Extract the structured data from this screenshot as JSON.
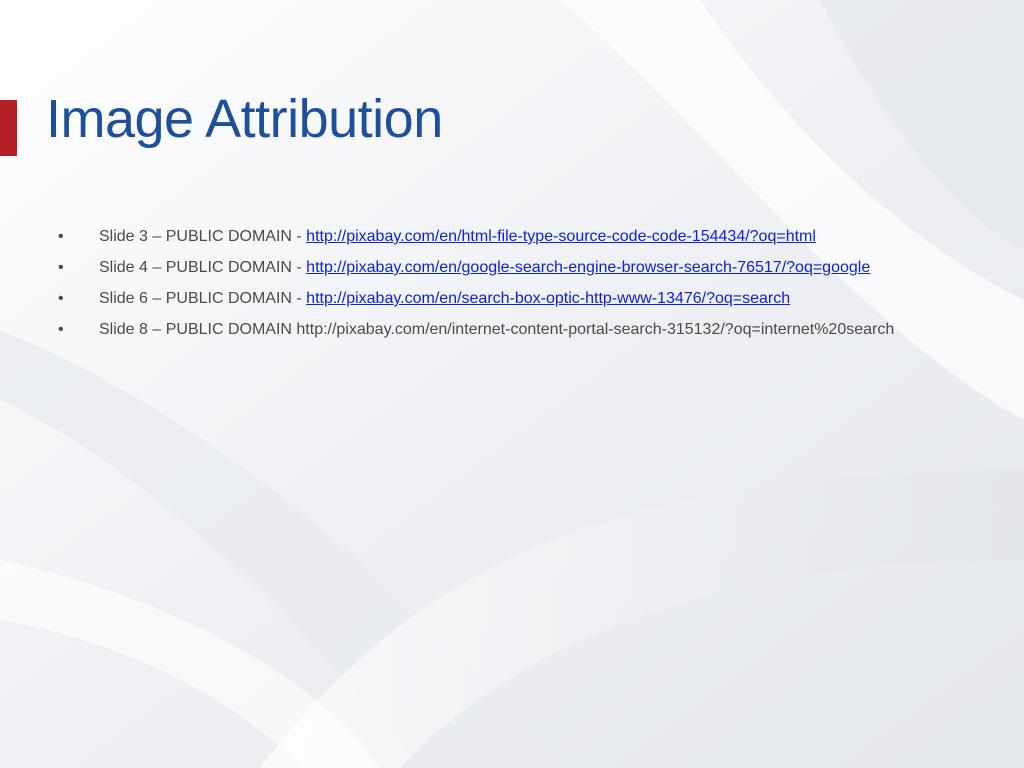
{
  "slide": {
    "title": "Image Attribution",
    "colors": {
      "title": "#1d4f9a",
      "accent": "#b21f24",
      "link": "#0b22d8",
      "text": "#4a4a4a"
    },
    "bullet_symbol": "•",
    "bullets": [
      {
        "prefix": "Slide 3 – PUBLIC DOMAIN - ",
        "link": "http://pixabay.com/en/html-file-type-source-code-code-154434/?oq=html"
      },
      {
        "prefix": "Slide 4 – PUBLIC DOMAIN -  ",
        "link": "http://pixabay.com/en/google-search-engine-browser-search-76517/?oq=google"
      },
      {
        "prefix": "Slide 6 – PUBLIC DOMAIN - ",
        "link": "http://pixabay.com/en/search-box-optic-http-www-13476/?oq=search"
      },
      {
        "prefix": "Slide 8 – PUBLIC DOMAIN  ",
        "text": "http://pixabay.com/en/internet-content-portal-search-315132/?oq=internet%20search"
      }
    ]
  }
}
